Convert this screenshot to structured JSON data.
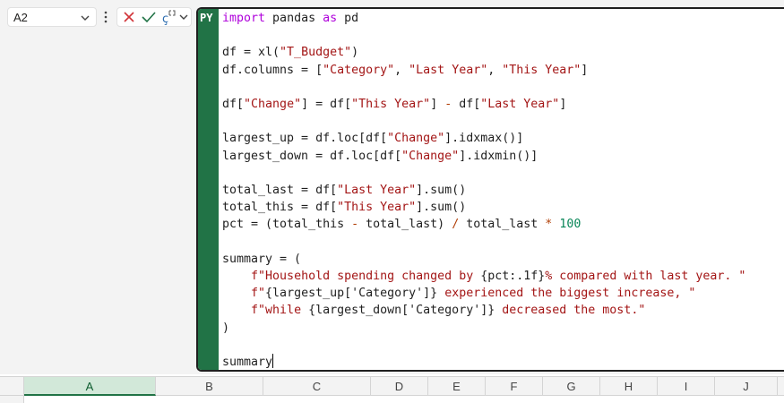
{
  "name_box": {
    "value": "A2"
  },
  "editor": {
    "badge": "PY",
    "lines": [
      [
        [
          "kw",
          "import"
        ],
        [
          "t",
          " pandas "
        ],
        [
          "kw",
          "as"
        ],
        [
          "t",
          " pd"
        ]
      ],
      [],
      [
        [
          "t",
          "df = xl("
        ],
        [
          "str",
          "\"T_Budget\""
        ],
        [
          "t",
          ")"
        ]
      ],
      [
        [
          "t",
          "df.columns = ["
        ],
        [
          "str",
          "\"Category\""
        ],
        [
          "t",
          ", "
        ],
        [
          "str",
          "\"Last Year\""
        ],
        [
          "t",
          ", "
        ],
        [
          "str",
          "\"This Year\""
        ],
        [
          "t",
          "]"
        ]
      ],
      [],
      [
        [
          "t",
          "df["
        ],
        [
          "str",
          "\"Change\""
        ],
        [
          "t",
          "] = df["
        ],
        [
          "str",
          "\"This Year\""
        ],
        [
          "t",
          "] "
        ],
        [
          "op",
          "-"
        ],
        [
          "t",
          " df["
        ],
        [
          "str",
          "\"Last Year\""
        ],
        [
          "t",
          "]"
        ]
      ],
      [],
      [
        [
          "t",
          "largest_up = df.loc[df["
        ],
        [
          "str",
          "\"Change\""
        ],
        [
          "t",
          "].idxmax()]"
        ]
      ],
      [
        [
          "t",
          "largest_down = df.loc[df["
        ],
        [
          "str",
          "\"Change\""
        ],
        [
          "t",
          "].idxmin()]"
        ]
      ],
      [],
      [
        [
          "t",
          "total_last = df["
        ],
        [
          "str",
          "\"Last Year\""
        ],
        [
          "t",
          "].sum()"
        ]
      ],
      [
        [
          "t",
          "total_this = df["
        ],
        [
          "str",
          "\"This Year\""
        ],
        [
          "t",
          "].sum()"
        ]
      ],
      [
        [
          "t",
          "pct = (total_this "
        ],
        [
          "op",
          "-"
        ],
        [
          "t",
          " total_last) "
        ],
        [
          "op",
          "/"
        ],
        [
          "t",
          " total_last "
        ],
        [
          "op",
          "*"
        ],
        [
          "t",
          " "
        ],
        [
          "num",
          "100"
        ]
      ],
      [],
      [
        [
          "t",
          "summary = ("
        ]
      ],
      [
        [
          "t",
          "    "
        ],
        [
          "str",
          "f\"Household spending changed by "
        ],
        [
          "t",
          "{pct:.1f}"
        ],
        [
          "str",
          "% compared with last year. \""
        ]
      ],
      [
        [
          "t",
          "    "
        ],
        [
          "str",
          "f\""
        ],
        [
          "t",
          "{largest_up['Category']}"
        ],
        [
          "str",
          " experienced the biggest increase, \""
        ]
      ],
      [
        [
          "t",
          "    "
        ],
        [
          "str",
          "f\"while "
        ],
        [
          "t",
          "{largest_down['Category']}"
        ],
        [
          "str",
          " decreased the most.\""
        ]
      ],
      [
        [
          "t",
          ")"
        ]
      ],
      [],
      [
        [
          "t",
          "summary"
        ],
        [
          "caret",
          ""
        ]
      ]
    ]
  },
  "columns": [
    {
      "label": "A",
      "selected": true
    },
    {
      "label": "B",
      "selected": false
    },
    {
      "label": "C",
      "selected": false
    },
    {
      "label": "D",
      "selected": false
    },
    {
      "label": "E",
      "selected": false
    },
    {
      "label": "F",
      "selected": false
    },
    {
      "label": "G",
      "selected": false
    },
    {
      "label": "H",
      "selected": false
    },
    {
      "label": "I",
      "selected": false
    },
    {
      "label": "J",
      "selected": false
    }
  ],
  "colors": {
    "accent": "#217346",
    "cancel": "#d13438",
    "confirm": "#217346"
  },
  "icons": {
    "namebox_dropdown": "chevron-down-icon",
    "more": "vertical-dots-icon",
    "cancel": "x-icon",
    "confirm": "check-icon",
    "python_toggle": "python-mode-icon",
    "editor_dropdown": "chevron-down-icon"
  }
}
